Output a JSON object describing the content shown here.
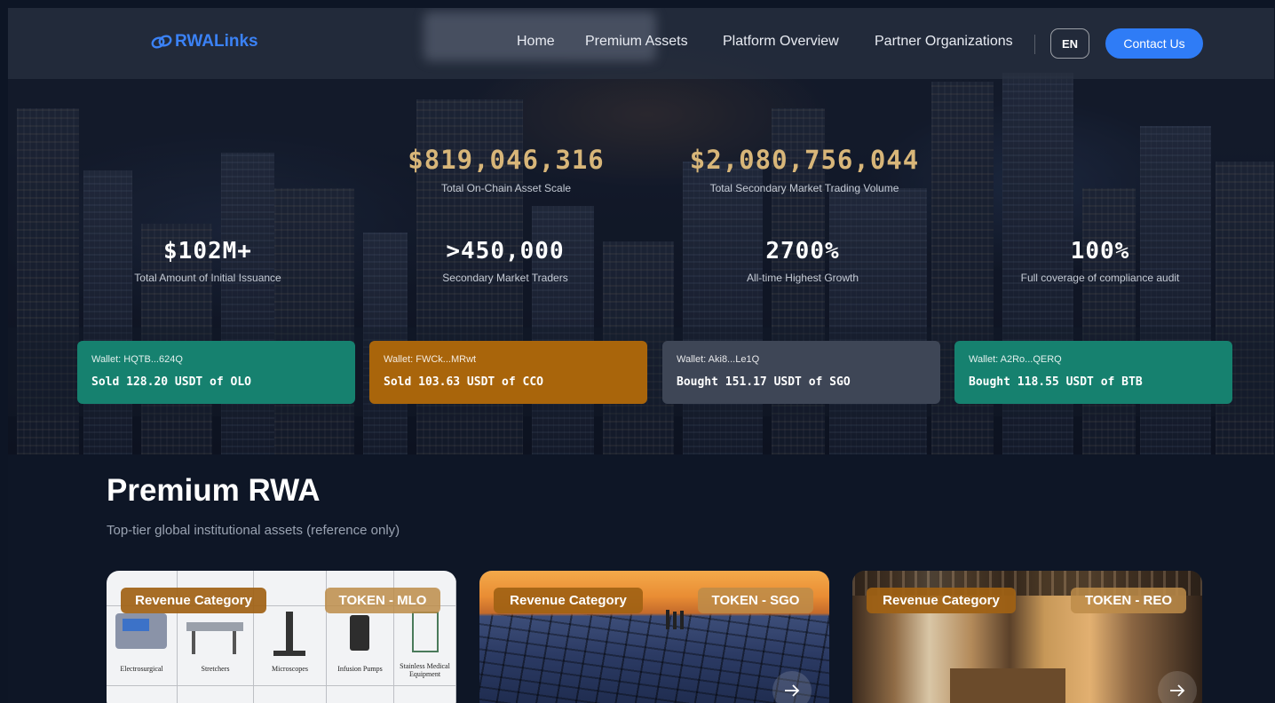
{
  "nav": {
    "logo_text": "RWALinks",
    "links": [
      "Home",
      "Premium Assets",
      "Platform Overview",
      "Partner Organizations"
    ],
    "lang": "EN",
    "contact": "Contact Us"
  },
  "hero": {
    "top_stats": [
      {
        "value": "$819,046,316",
        "label": "Total On-Chain Asset Scale"
      },
      {
        "value": "$2,080,756,044",
        "label": "Total Secondary Market Trading Volume"
      }
    ],
    "stats": [
      {
        "value": "$102M+",
        "label": "Total Amount of Initial Issuance"
      },
      {
        "value": ">450,000",
        "label": "Secondary Market Traders"
      },
      {
        "value": "2700%",
        "label": "All-time Highest Growth"
      },
      {
        "value": "100%",
        "label": "Full coverage of compliance audit"
      }
    ],
    "ticker": [
      {
        "wallet": "Wallet: HQTB...624Q",
        "action": "Sold 128.20 USDT of OLO",
        "color": "#16816f"
      },
      {
        "wallet": "Wallet: FWCk...MRwt",
        "action": "Sold 103.63 USDT of CCO",
        "color": "#a9650b"
      },
      {
        "wallet": "Wallet: Aki8...Le1Q",
        "action": "Bought 151.17 USDT of SGO",
        "color": "#3e4656"
      },
      {
        "wallet": "Wallet: A2Ro...QERQ",
        "action": "Bought 118.55 USDT of BTB",
        "color": "#16816f"
      }
    ]
  },
  "premium": {
    "title": "Premium RWA",
    "subtitle": "Top-tier global institutional assets (reference only)",
    "cards": [
      {
        "category": "Revenue Category",
        "token": "TOKEN - MLO",
        "catalog_labels": [
          "Electrosurgical",
          "Stretchers",
          "Microscopes",
          "Infusion Pumps",
          "Stainless Medical Equipment"
        ]
      },
      {
        "category": "Revenue Category",
        "token": "TOKEN - SGO"
      },
      {
        "category": "Revenue Category",
        "token": "TOKEN - REO"
      }
    ]
  }
}
